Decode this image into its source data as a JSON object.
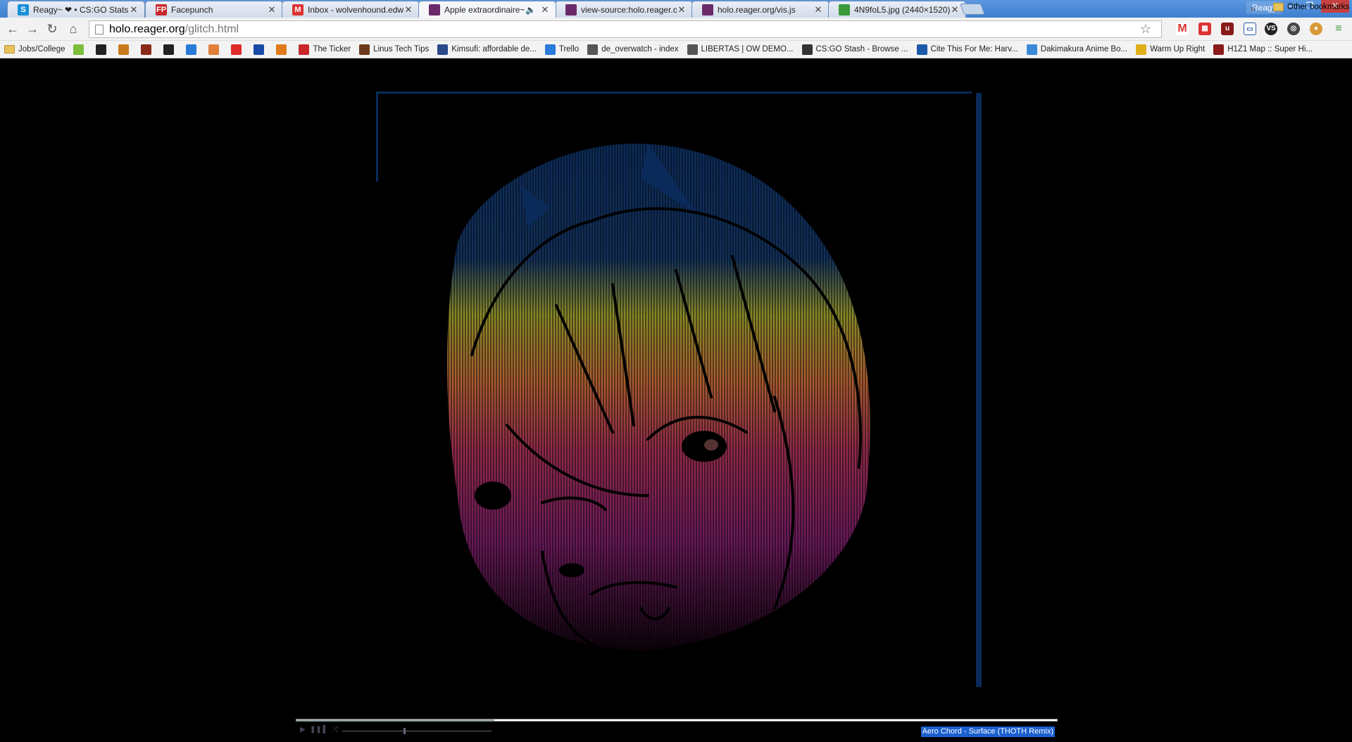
{
  "window": {
    "profile_name": "Reagy",
    "tabs": [
      {
        "title": "Reagy~ ❤ • CS:GO Stats",
        "favicon": "S",
        "favicon_color": "#1a8fd8"
      },
      {
        "title": "Facepunch",
        "favicon": "FP",
        "favicon_color": "#c8262b"
      },
      {
        "title": "Inbox - wolvenhound.edwar",
        "favicon": "M",
        "favicon_color": "#d33"
      },
      {
        "title": "Apple extraordinaire~",
        "favicon": "",
        "favicon_color": "#6a2a6a",
        "active": true,
        "audio": true
      },
      {
        "title": "view-source:holo.reager.org",
        "favicon": "",
        "favicon_color": "#6a2a6a"
      },
      {
        "title": "holo.reager.org/vis.js",
        "favicon": "",
        "favicon_color": "#6a2a6a"
      },
      {
        "title": "4N9foL5.jpg (2440×1520)",
        "favicon": "",
        "favicon_color": "#3a9a3a"
      }
    ]
  },
  "toolbar": {
    "url_host": "holo.reager.org",
    "url_path": "/glitch.html"
  },
  "bookmarks": {
    "items": [
      {
        "label": "Jobs/College",
        "type": "folder"
      },
      {
        "label": "",
        "icon_color": "#7cbf3a"
      },
      {
        "label": "",
        "icon_color": "#222"
      },
      {
        "label": "",
        "icon_color": "#c87a1a"
      },
      {
        "label": "",
        "icon_color": "#8a2a1a"
      },
      {
        "label": "",
        "icon_color": "#222"
      },
      {
        "label": "",
        "icon_color": "#2a7ad8"
      },
      {
        "label": "",
        "icon_color": "#e0803a"
      },
      {
        "label": "",
        "icon_color": "#e02a2a"
      },
      {
        "label": "",
        "icon_color": "#1a4aa8"
      },
      {
        "label": "",
        "icon_color": "#e07a1a"
      },
      {
        "label": "The Ticker",
        "icon_color": "#c8262b"
      },
      {
        "label": "Linus Tech Tips",
        "icon_color": "#6a3a1a"
      },
      {
        "label": "Kimsufi: affordable de...",
        "icon_color": "#2a4a8a"
      },
      {
        "label": "Trello",
        "icon_color": "#2a7ad8"
      },
      {
        "label": "de_overwatch - index",
        "icon_color": "#555"
      },
      {
        "label": "LIBERTAS | OW DEMO...",
        "icon_color": "#555"
      },
      {
        "label": "CS:GO Stash - Browse ...",
        "icon_color": "#333"
      },
      {
        "label": "Cite This For Me: Harv...",
        "icon_color": "#1a5aa8"
      },
      {
        "label": "Dakimakura Anime Bo...",
        "icon_color": "#3a8ad8"
      },
      {
        "label": "Warm Up Right",
        "icon_color": "#e0b01a"
      },
      {
        "label": "H1Z1 Map :: Super Hi...",
        "icon_color": "#8a1a1a"
      }
    ],
    "more": "»",
    "other": "Other bookmarks"
  },
  "player": {
    "track_title": "Aero Chord - Surface (THOTH Remix)",
    "progress_fraction": 0.26,
    "volume_fraction": 0.41,
    "play_symbol": "▶",
    "pause_symbol": "❚❚",
    "stop_symbol": "▌",
    "shuffle_symbol": "⤮"
  }
}
